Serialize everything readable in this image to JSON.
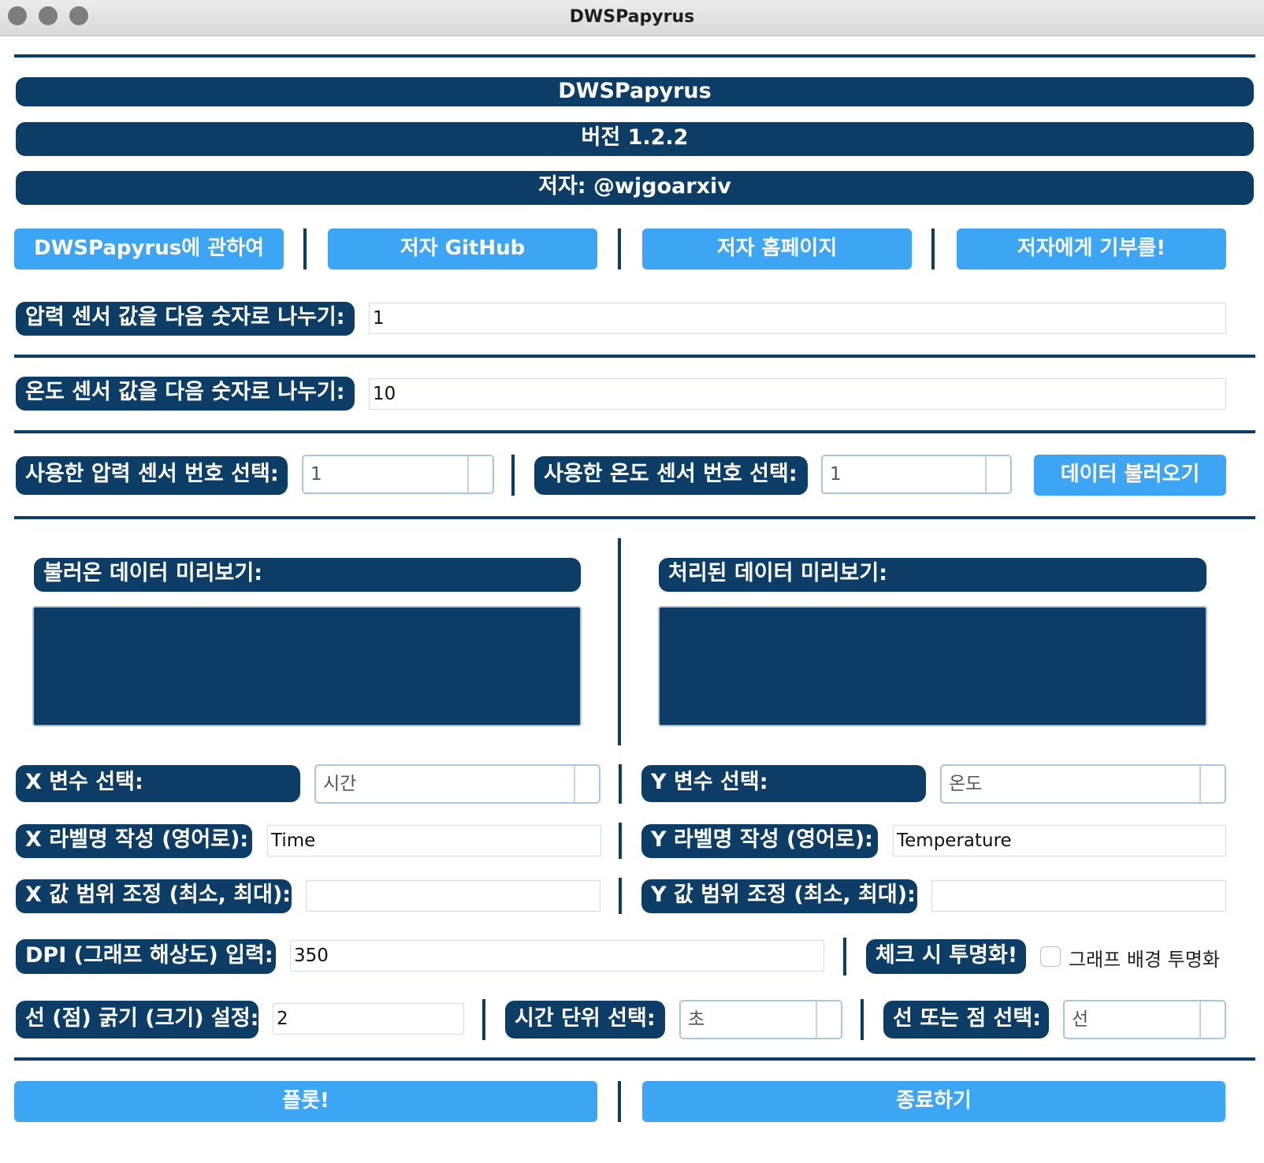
{
  "window": {
    "title": "DWSPapyrus"
  },
  "header": {
    "app_name": "DWSPapyrus",
    "version": "버전 1.2.2",
    "author": "저자: @wjgoarxiv"
  },
  "links": {
    "about": "DWSPapyrus에 관하여",
    "github": "저자 GitHub",
    "homepage": "저자 홈페이지",
    "donate": "저자에게 기부를!"
  },
  "divisors": {
    "pressure_label": "압력 센서 값을 다음 숫자로 나누기:",
    "pressure_value": "1",
    "temperature_label": "온도 센서 값을 다음 숫자로 나누기:",
    "temperature_value": "10"
  },
  "sensors": {
    "pressure_label": "사용한 압력 센서 번호 선택:",
    "pressure_value": "1",
    "temperature_label": "사용한 온도 센서 번호 선택:",
    "temperature_value": "1",
    "load_button": "데이터 불러오기"
  },
  "preview": {
    "loaded_label": "불러온 데이터 미리보기:",
    "processed_label": "처리된 데이터 미리보기:"
  },
  "plot_settings": {
    "x_var_label": "X 변수 선택:",
    "x_var_value": "시간",
    "y_var_label": "Y 변수 선택:",
    "y_var_value": "온도",
    "x_label_label": "X 라벨명 작성 (영어로):",
    "x_label_value": "Time",
    "y_label_label": "Y 라벨명 작성 (영어로):",
    "y_label_value": "Temperature",
    "x_range_label": "X 값 범위 조정 (최소, 최대):",
    "x_range_value": "",
    "y_range_label": "Y 값 범위 조정 (최소, 최대):",
    "y_range_value": "",
    "dpi_label": "DPI (그래프 해상도) 입력:",
    "dpi_value": "350",
    "transparent_label": "체크 시 투명화!",
    "transparent_checkbox_label": "그래프 배경 투명화",
    "transparent_checked": false,
    "line_width_label": "선 (점) 굵기 (크기) 설정:",
    "line_width_value": "2",
    "time_unit_label": "시간 단위 선택:",
    "time_unit_value": "초",
    "line_or_point_label": "선 또는 점 선택:",
    "line_or_point_value": "선"
  },
  "actions": {
    "plot": "플롯!",
    "quit": "종료하기"
  },
  "colors": {
    "navy": "#0b3d66",
    "button_blue": "#3ca5f4"
  }
}
